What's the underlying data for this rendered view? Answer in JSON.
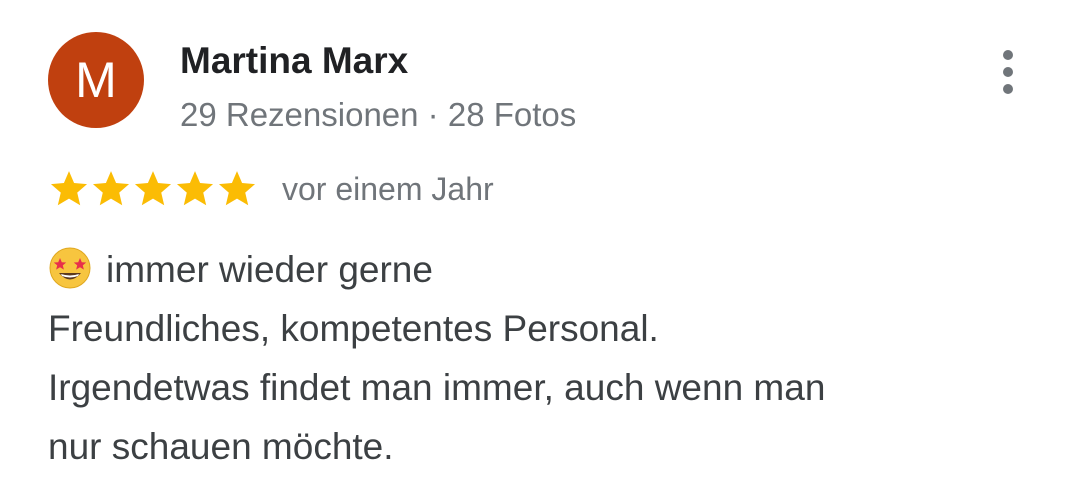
{
  "review": {
    "author": {
      "initial": "M",
      "name": "Martina Marx",
      "meta": "29 Rezensionen · 28 Fotos",
      "avatar_color": "#c0400f"
    },
    "rating": {
      "stars": 5,
      "max": 5,
      "star_color": "#fbbc04",
      "date": "vor einem Jahr"
    },
    "text": {
      "emoji": "star-struck-emoji",
      "line1": "immer wieder gerne",
      "line2": "Freundliches, kompetentes Personal.",
      "line3": "Irgendetwas findet man immer, auch wenn man",
      "line4": "nur schauen möchte."
    },
    "more_icon": "more-vert-icon"
  }
}
